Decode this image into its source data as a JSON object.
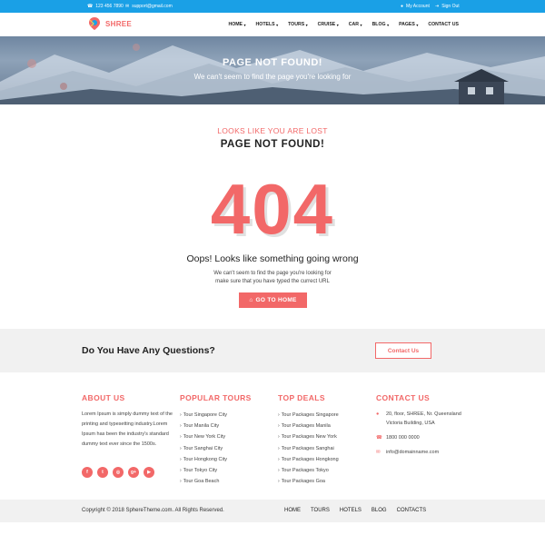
{
  "topbar": {
    "phone": "123 456 7890",
    "email": "support@gmail.com",
    "my_account": "My Account",
    "sign_out": "Sign Out"
  },
  "brand": {
    "name": "SHREE",
    "accent": "#f26868",
    "topbar_color": "#1aa0e6"
  },
  "nav": [
    {
      "label": "HOME",
      "dropdown": true
    },
    {
      "label": "HOTELS",
      "dropdown": true
    },
    {
      "label": "TOURS",
      "dropdown": true
    },
    {
      "label": "CRUISE",
      "dropdown": true
    },
    {
      "label": "CAR",
      "dropdown": true
    },
    {
      "label": "BLOG",
      "dropdown": true
    },
    {
      "label": "PAGES",
      "dropdown": true
    },
    {
      "label": "CONTACT US",
      "dropdown": false
    }
  ],
  "hero": {
    "title": "PAGE NOT FOUND!",
    "subtitle": "We can't seem to find the page you're looking for"
  },
  "error": {
    "lost": "LOOKS LIKE YOU ARE LOST",
    "title": "PAGE NOT FOUND!",
    "code": "404",
    "oops": "Oops! Looks like something going wrong",
    "desc_line1": "We can't seem to find the page you're looking for",
    "desc_line2": "make sure that you have typed the currect URL",
    "go_home": "GO TO HOME"
  },
  "questions": {
    "text": "Do You Have Any Questions?",
    "button": "Contact Us"
  },
  "footer": {
    "about": {
      "title": "ABOUT US",
      "text": "Lorem Ipsum is simply dummy text of the printing and typesetting industry.Lorem Ipsum has been the industry's standard dummy text ever since the 1500s."
    },
    "popular": {
      "title": "POPULAR TOURS",
      "items": [
        "Tour Singapore City",
        "Tour Manila City",
        "Tour New York City",
        "Tour Sanghai City",
        "Tour Hongkong City",
        "Tour Tokyo City",
        "Tour Goa Beach"
      ]
    },
    "deals": {
      "title": "TOP DEALS",
      "items": [
        "Tour Packages Singapore",
        "Tour Packages Manila",
        "Tour Packages New York",
        "Tour Packages Sanghai",
        "Tour Packages Hongkong",
        "Tour Packages Tokyo",
        "Tour Packages Goa"
      ]
    },
    "contact": {
      "title": "CONTACT US",
      "address_line1": "20, floor, SHREE, Nr. Queensland",
      "address_line2": "Victoria Building, USA",
      "phone": "1800 000 0000",
      "email": "info@domainname.com"
    },
    "socials": [
      {
        "icon": "facebook-icon",
        "glyph": "f"
      },
      {
        "icon": "twitter-icon",
        "glyph": "t"
      },
      {
        "icon": "instagram-icon",
        "glyph": "◎"
      },
      {
        "icon": "google-plus-icon",
        "glyph": "g+"
      },
      {
        "icon": "youtube-icon",
        "glyph": "▶"
      }
    ]
  },
  "bottom": {
    "copyright": "Copyright © 2018 SphereTheme.com. All Rights Reserved.",
    "links": [
      "HOME",
      "TOURS",
      "HOTELS",
      "BLOG",
      "CONTACTS"
    ]
  }
}
